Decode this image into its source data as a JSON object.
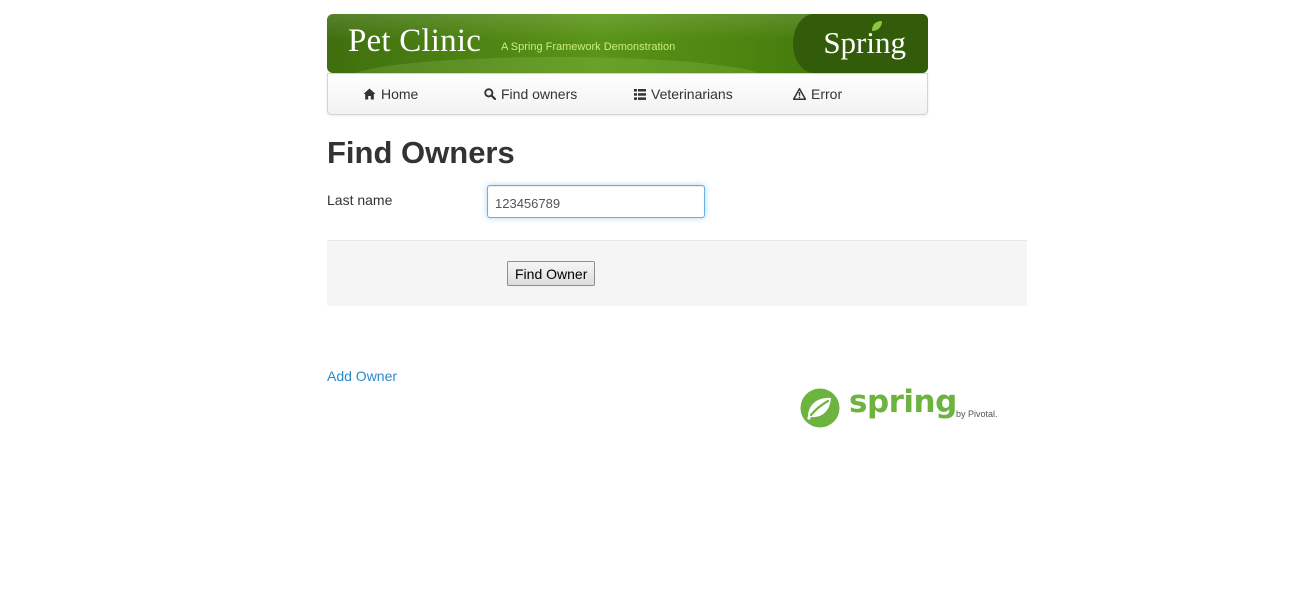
{
  "banner": {
    "title": "Pet Clinic",
    "subtitle": "A Spring Framework Demonstration",
    "brand": "Spring"
  },
  "nav": {
    "items": [
      {
        "label": "Home",
        "icon": "home-icon"
      },
      {
        "label": "Find owners",
        "icon": "search-icon"
      },
      {
        "label": "Veterinarians",
        "icon": "list-icon"
      },
      {
        "label": "Error",
        "icon": "warning-icon"
      }
    ]
  },
  "page": {
    "title": "Find Owners"
  },
  "form": {
    "last_name_label": "Last name",
    "last_name_value": "123456789",
    "submit_label": "Find Owner"
  },
  "links": {
    "add_owner": "Add Owner"
  },
  "footer": {
    "logo_text": "spring",
    "logo_by": "by Pivotal."
  },
  "colors": {
    "banner_green": "#4c840f",
    "spring_green": "#6db33f",
    "link_blue": "#2a8ac8",
    "focus_blue": "#66afe9"
  }
}
